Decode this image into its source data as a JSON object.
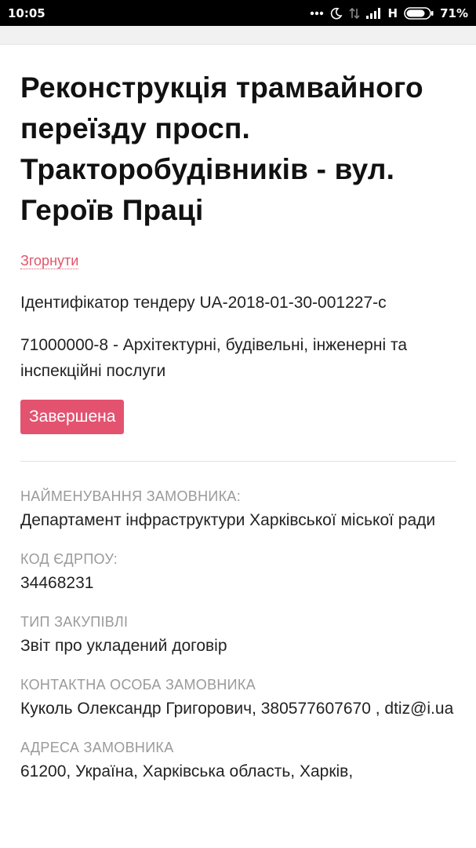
{
  "status_bar": {
    "time": "10:05",
    "network": "H",
    "battery": "71%"
  },
  "tender": {
    "title": "Реконструкція трамвайного переїзду просп. Тракторобудівників - вул. Героїв Праці",
    "collapse_label": "Згорнути",
    "tender_id": "Ідентифікатор тендеру UA-2018-01-30-001227-c",
    "cpv": "71000000-8 - Архітектурні, будівельні, інженерні та інспекційні послуги",
    "status": "Завершена"
  },
  "fields": [
    {
      "label": "НАЙМЕНУВАННЯ ЗАМОВНИКА:",
      "value": "Департамент інфраструктури Харківської міської ради"
    },
    {
      "label": "КОД ЄДРПОУ:",
      "value": "34468231"
    },
    {
      "label": "ТИП ЗАКУПІВЛІ",
      "value": "Звіт про укладений договір"
    },
    {
      "label": "КОНТАКТНА ОСОБА ЗАМОВНИКА",
      "value": "Куколь Олександр Григорович, 380577607670 , dtiz@i.ua"
    },
    {
      "label": "АДРЕСА ЗАМОВНИКА",
      "value": "61200, Україна, Харківська область, Харків,"
    }
  ],
  "colors": {
    "accent": "#e35370",
    "link": "#e0556b",
    "label": "#9a9a9a"
  }
}
